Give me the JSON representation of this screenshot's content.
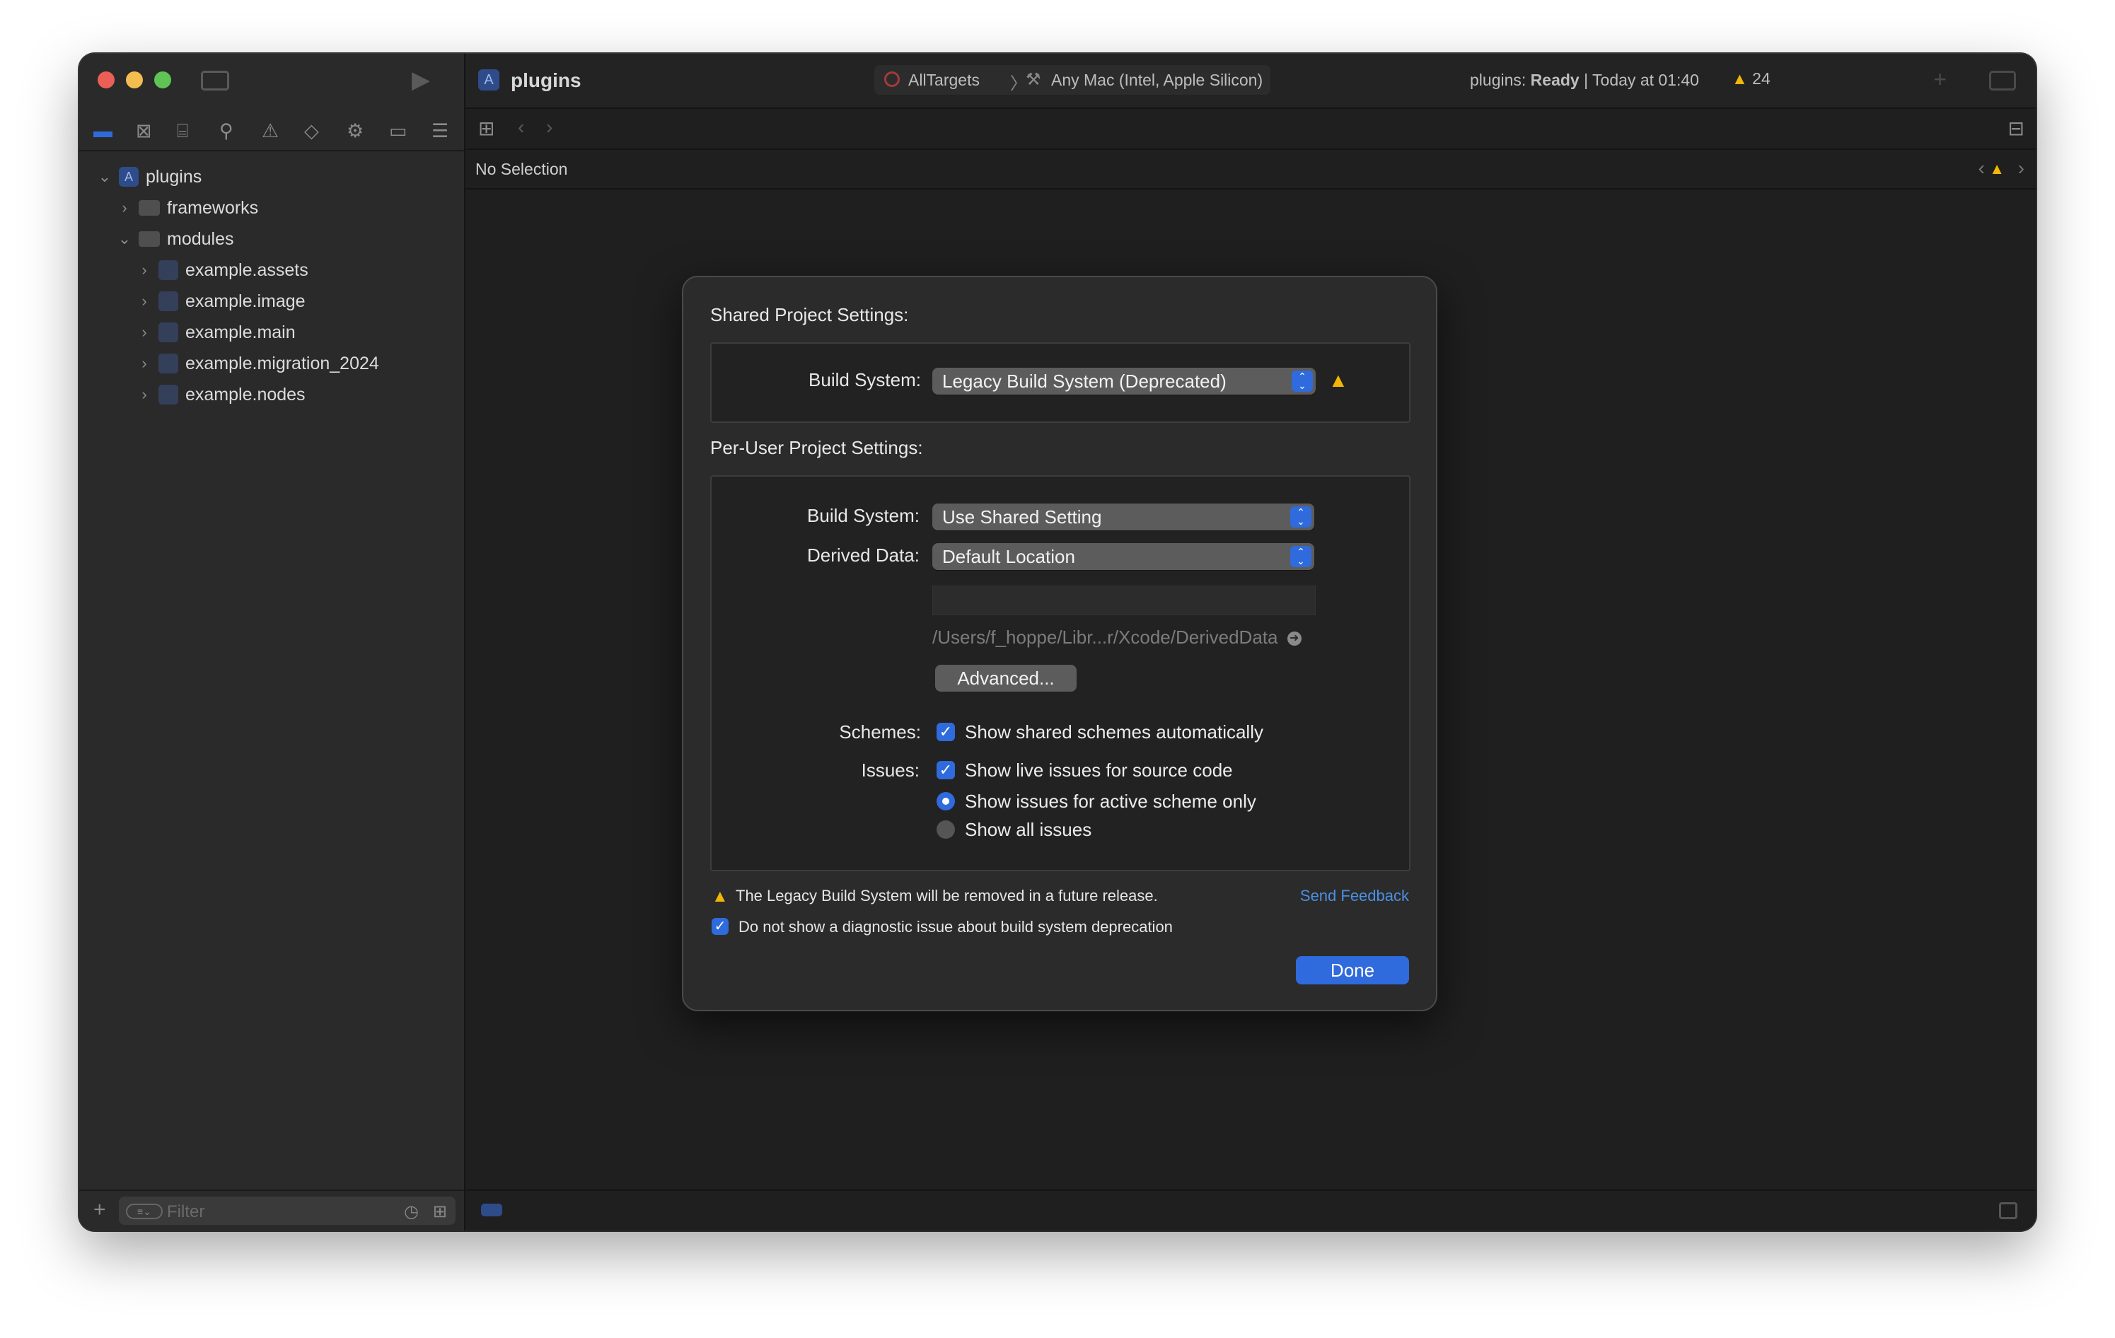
{
  "window": {
    "title": "plugins",
    "scheme": "AllTargets",
    "destination": "Any Mac (Intel, Apple Silicon)",
    "status_project": "plugins:",
    "status_state": "Ready",
    "status_time": "| Today at 01:40",
    "warning_count": "24"
  },
  "editor": {
    "jump_bar": "No Selection"
  },
  "navigator": {
    "root": "plugins",
    "items": [
      {
        "label": "frameworks",
        "level": 1,
        "expanded": false,
        "kind": "folder"
      },
      {
        "label": "modules",
        "level": 1,
        "expanded": true,
        "kind": "folder"
      },
      {
        "label": "example.assets",
        "level": 2,
        "expanded": false,
        "kind": "module"
      },
      {
        "label": "example.image",
        "level": 2,
        "expanded": false,
        "kind": "module"
      },
      {
        "label": "example.main",
        "level": 2,
        "expanded": false,
        "kind": "module"
      },
      {
        "label": "example.migration_2024",
        "level": 2,
        "expanded": false,
        "kind": "module"
      },
      {
        "label": "example.nodes",
        "level": 2,
        "expanded": false,
        "kind": "module"
      }
    ],
    "filter_placeholder": "Filter"
  },
  "dialog": {
    "shared_heading": "Shared Project Settings:",
    "shared_build_system_label": "Build System:",
    "shared_build_system_value": "Legacy Build System (Deprecated)",
    "per_user_heading": "Per-User Project Settings:",
    "user_build_system_label": "Build System:",
    "user_build_system_value": "Use Shared Setting",
    "derived_data_label": "Derived Data:",
    "derived_data_value": "Default Location",
    "derived_data_path": "/Users/f_hoppe/Libr...r/Xcode/DerivedData",
    "advanced_button": "Advanced...",
    "schemes_label": "Schemes:",
    "schemes_option": "Show shared schemes automatically",
    "issues_label": "Issues:",
    "issues_live": "Show live issues for source code",
    "issues_active_scheme": "Show issues for active scheme only",
    "issues_all": "Show all issues",
    "deprecation_warning": "The Legacy Build System will be removed in a future release.",
    "send_feedback": "Send Feedback",
    "suppress_diagnostic": "Do not show a diagnostic issue about build system deprecation",
    "done_button": "Done"
  },
  "colors": {
    "accent": "#2f6bdc",
    "warning": "#f2b705",
    "link": "#4a90e2"
  }
}
